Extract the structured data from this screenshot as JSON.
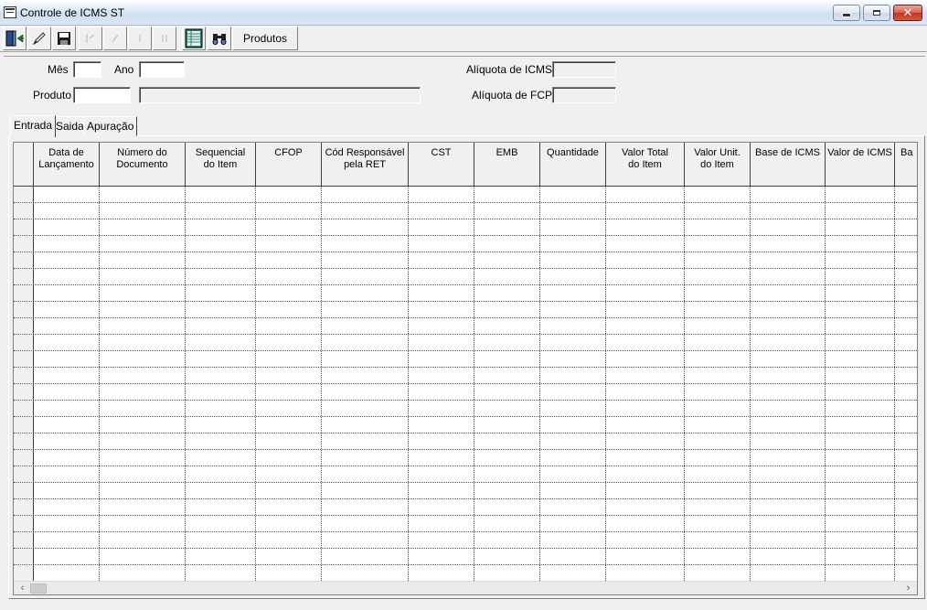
{
  "window": {
    "title": "Controle de ICMS ST",
    "min_label": "",
    "max_label": "",
    "close_label": "✕"
  },
  "toolbar": {
    "produtos_label": "Produtos",
    "icons": [
      "exit-icon",
      "edit-icon",
      "save-icon",
      "first-icon",
      "prev-icon",
      "next-icon",
      "last-icon",
      "grid-view-icon",
      "find-icon"
    ]
  },
  "form": {
    "mes_label": "Mês",
    "mes_value": "",
    "ano_label": "Ano",
    "ano_value": "",
    "produto_label": "Produto",
    "produto_code": "",
    "produto_desc": "",
    "aliquota_icms_label": "Alíquota de ICMS",
    "aliquota_icms_value": "",
    "aliquota_fcp_label": "Alíquota de FCP",
    "aliquota_fcp_value": ""
  },
  "tabs": [
    {
      "label": "Entrada",
      "active": true
    },
    {
      "label": "Saida",
      "active": false
    },
    {
      "label": "Apuração",
      "active": false
    }
  ],
  "grid": {
    "columns": [
      "Data de\nLançamento",
      "Número do\nDocumento",
      "Sequencial\ndo Item",
      "CFOP",
      "Cód Responsável\npela RET",
      "CST",
      "EMB",
      "Quantidade",
      "Valor Total\ndo Item",
      "Valor Unit.\ndo Item",
      "Base de ICMS",
      "Valor de ICMS",
      "Ba"
    ],
    "rows": [],
    "scroll_left": "‹",
    "scroll_right": "›"
  },
  "colors": {
    "window_bg": "#f0f0f0",
    "grid_bg": "#ffffff",
    "grid_line": "#404040"
  }
}
